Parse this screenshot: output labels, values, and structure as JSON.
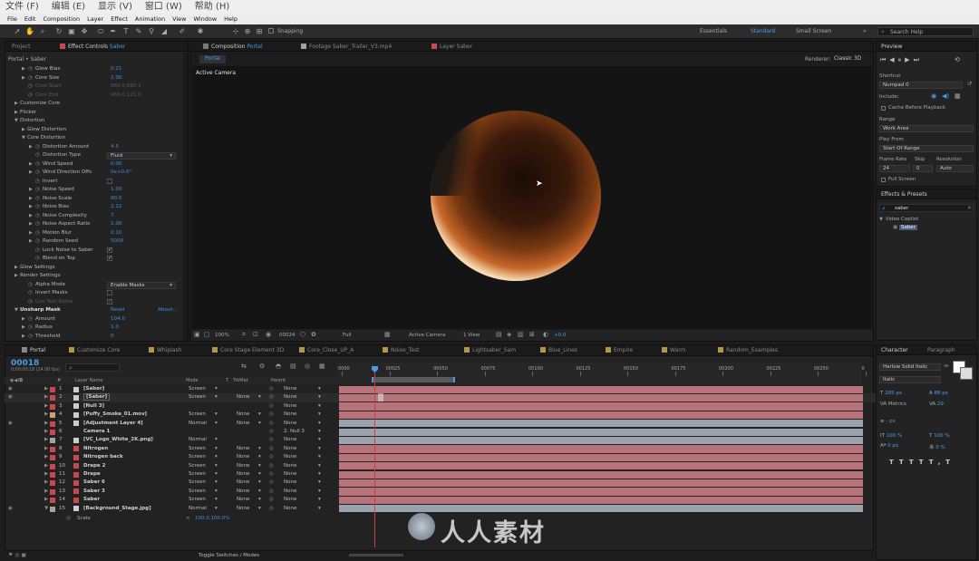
{
  "os_menu": [
    "文件 (F)",
    "编辑 (E)",
    "显示 (V)",
    "窗口 (W)",
    "帮助 (H)"
  ],
  "menubar": [
    "File",
    "Edit",
    "Composition",
    "Layer",
    "Effect",
    "Animation",
    "View",
    "Window",
    "Help"
  ],
  "toolbar": {
    "snapping": "Snapping",
    "workspaces": [
      "Essentials",
      "Standard",
      "Small Screen"
    ],
    "active_workspace": "Standard",
    "search_placeholder": "Search Help"
  },
  "left_panel": {
    "tab_project": "Project",
    "tab_effect_controls": "Effect Controls",
    "ec_layer": "Saber",
    "breadcrumb": "Portal • Saber",
    "rows": [
      {
        "label": "Glow Bias",
        "value": "0.21",
        "indent": 2,
        "toggle": "▶",
        "sw": true
      },
      {
        "label": "Core Size",
        "value": "2.00",
        "indent": 2,
        "toggle": "▶",
        "sw": true
      },
      {
        "label": "Core Start",
        "value": "960.0,690.2",
        "indent": 2,
        "toggle": "",
        "sw": true,
        "dim": true
      },
      {
        "label": "Core End",
        "value": "960.0,121.6",
        "indent": 2,
        "toggle": "",
        "sw": true,
        "dim": true
      },
      {
        "label": "Customize Core",
        "value": "",
        "indent": 1,
        "toggle": "▶",
        "sw": false
      },
      {
        "label": "Flicker",
        "value": "",
        "indent": 1,
        "toggle": "▶",
        "sw": false
      },
      {
        "label": "Distortion",
        "value": "",
        "indent": 1,
        "toggle": "▼",
        "sw": false
      },
      {
        "label": "Glow Distortion",
        "value": "",
        "indent": 2,
        "toggle": "▶",
        "sw": false
      },
      {
        "label": "Core Distortion",
        "value": "",
        "indent": 2,
        "toggle": "▼",
        "sw": false
      },
      {
        "label": "Distortion Amount",
        "value": "4.5",
        "indent": 3,
        "toggle": "▶",
        "sw": true
      },
      {
        "label": "Distortion Type",
        "value": "",
        "indent": 3,
        "toggle": "",
        "sw": true,
        "dropdown": "Fluid"
      },
      {
        "label": "Wind Speed",
        "value": "0.00",
        "indent": 3,
        "toggle": "▶",
        "sw": true
      },
      {
        "label": "Wind Direction Offs",
        "value": "0x+0.0°",
        "indent": 3,
        "toggle": "▶",
        "sw": true
      },
      {
        "label": "Invert",
        "value": "",
        "indent": 3,
        "toggle": "",
        "sw": true,
        "check": ""
      },
      {
        "label": "Noise Speed",
        "value": "1.00",
        "indent": 3,
        "toggle": "▶",
        "sw": true
      },
      {
        "label": "Noise Scale",
        "value": "90.0",
        "indent": 3,
        "toggle": "▶",
        "sw": true
      },
      {
        "label": "Noise Bias",
        "value": "2.12",
        "indent": 3,
        "toggle": "▶",
        "sw": true
      },
      {
        "label": "Noise Complexity",
        "value": "7",
        "indent": 3,
        "toggle": "▶",
        "sw": true
      },
      {
        "label": "Noise Aspect Ratio",
        "value": "1.00",
        "indent": 3,
        "toggle": "▶",
        "sw": true
      },
      {
        "label": "Motion Blur",
        "value": "0.10",
        "indent": 3,
        "toggle": "▶",
        "sw": true
      },
      {
        "label": "Random Seed",
        "value": "5000",
        "indent": 3,
        "toggle": "▶",
        "sw": true
      },
      {
        "label": "Lock Noise to Saber",
        "value": "",
        "indent": 3,
        "toggle": "",
        "sw": true,
        "check": "✓"
      },
      {
        "label": "Blend on Top",
        "value": "",
        "indent": 3,
        "toggle": "",
        "sw": true,
        "check": "✓"
      },
      {
        "label": "Glow Settings",
        "value": "",
        "indent": 1,
        "toggle": "▶",
        "sw": false
      },
      {
        "label": "Render Settings",
        "value": "",
        "indent": 1,
        "toggle": "▶",
        "sw": false
      },
      {
        "label": "Alpha Mode",
        "value": "",
        "indent": 2,
        "toggle": "",
        "sw": true,
        "dropdown": "Enable Masks"
      },
      {
        "label": "Invert Masks",
        "value": "",
        "indent": 2,
        "toggle": "",
        "sw": true,
        "check": ""
      },
      {
        "label": "Use Text Alpha",
        "value": "",
        "indent": 2,
        "toggle": "",
        "sw": true,
        "check": "✓",
        "dim": true
      },
      {
        "label": "Unsharp Mask",
        "value": "Reset",
        "indent": 1,
        "toggle": "▼",
        "sw": false,
        "about": "About...",
        "bold": true
      },
      {
        "label": "Amount",
        "value": "104.0",
        "indent": 2,
        "toggle": "▶",
        "sw": true
      },
      {
        "label": "Radius",
        "value": "1.0",
        "indent": 2,
        "toggle": "▶",
        "sw": true
      },
      {
        "label": "Threshold",
        "value": "0",
        "indent": 2,
        "toggle": "▶",
        "sw": true
      }
    ]
  },
  "composition": {
    "tab_comp": "Composition",
    "comp_name": "Portal",
    "tab_footage": "Footage Saber_Trailer_V3.mp4",
    "tab_layer": "Layer Saber",
    "crumb": "Portal",
    "renderer_label": "Renderer:",
    "renderer": "Classic 3D",
    "view_label": "Active Camera",
    "footer": {
      "zoom": "100%",
      "timecode": "00024",
      "resolution": "Full",
      "camera": "Active Camera",
      "views": "1 View",
      "exposure": "+0.0"
    }
  },
  "timeline_tabs": [
    "Portal",
    "Customize Core",
    "Whiplash",
    "Core Stage Element 3D",
    "Core_Close_UP_A",
    "Noise_Test",
    "Lightsaber_Sam",
    "Blue_Lines",
    "Empire",
    "Warm",
    "Random_Examples"
  ],
  "timeline": {
    "timecode": "00018",
    "fps": "0:00:00:18 (24.00 fps)",
    "col_num": "#",
    "col_name": "Layer Name",
    "col_mode": "Mode",
    "col_t": "T",
    "col_trkmat": "TrkMat",
    "col_parent": "Parent",
    "ruler": [
      "0000",
      "00025",
      "00050",
      "00075",
      "00100",
      "00125",
      "00150",
      "00175",
      "00200",
      "00225",
      "00250",
      "0"
    ],
    "layers": [
      {
        "num": "1",
        "name": "[Saber]",
        "mode": "Screen",
        "trk": "",
        "parent": "None",
        "color": "#c9474d",
        "bar": "#b8727a"
      },
      {
        "num": "2",
        "name": "[Saber]",
        "mode": "Screen",
        "trk": "None",
        "parent": "None",
        "color": "#c9474d",
        "bar": "#b8727a"
      },
      {
        "num": "3",
        "name": "[Null 3]",
        "mode": "",
        "trk": "",
        "parent": "None",
        "color": "#c9474d",
        "bar": "#b8727a"
      },
      {
        "num": "4",
        "name": "[Puffy_Smoke_01.mov]",
        "mode": "Screen",
        "trk": "None",
        "parent": "None",
        "color": "#c8a46e",
        "bar": "#b8727a"
      },
      {
        "num": "5",
        "name": "[Adjustment Layer 4]",
        "mode": "Normal",
        "trk": "None",
        "parent": "None",
        "color": "#c9474d",
        "bar": "#9aa3ad"
      },
      {
        "num": "6",
        "name": "Camera 1",
        "mode": "",
        "trk": "",
        "parent": "2. Null 3",
        "color": "#c9474d",
        "bar": "#9aa3ad"
      },
      {
        "num": "7",
        "name": "[VC_Logo_White_2K.png]",
        "mode": "Normal",
        "trk": "",
        "parent": "None",
        "color": "#a4a4a4",
        "bar": "#9aa3ad"
      },
      {
        "num": "8",
        "name": "Nitrogen",
        "mode": "Screen",
        "trk": "None",
        "parent": "None",
        "color": "#c9474d",
        "bar": "#b8727a"
      },
      {
        "num": "9",
        "name": "Nitrogen back",
        "mode": "Screen",
        "trk": "None",
        "parent": "None",
        "color": "#c9474d",
        "bar": "#b8727a"
      },
      {
        "num": "10",
        "name": "Drape 2",
        "mode": "Screen",
        "trk": "None",
        "parent": "None",
        "color": "#c9474d",
        "bar": "#b8727a"
      },
      {
        "num": "11",
        "name": "Drape",
        "mode": "Screen",
        "trk": "None",
        "parent": "None",
        "color": "#c9474d",
        "bar": "#b8727a"
      },
      {
        "num": "12",
        "name": "Saber 6",
        "mode": "Screen",
        "trk": "None",
        "parent": "None",
        "color": "#c9474d",
        "bar": "#b8727a"
      },
      {
        "num": "13",
        "name": "Saber 3",
        "mode": "Screen",
        "trk": "None",
        "parent": "None",
        "color": "#c9474d",
        "bar": "#b8727a"
      },
      {
        "num": "14",
        "name": "Saber",
        "mode": "Screen",
        "trk": "None",
        "parent": "None",
        "color": "#c9474d",
        "bar": "#b8727a"
      },
      {
        "num": "15",
        "name": "[Background_Stage.jpg]",
        "mode": "Normal",
        "trk": "None",
        "parent": "None",
        "color": "#a4a4a4",
        "bar": "#9aa3ad"
      }
    ],
    "scale_label": "Scale",
    "scale_value": "100.0,100.0%",
    "toggle_label": "Toggle Switches / Modes"
  },
  "preview": {
    "title": "Preview",
    "shortcut_label": "Shortcut",
    "shortcut": "Numpad 0",
    "include_label": "Include:",
    "cache": "Cache Before Playback",
    "range_label": "Range",
    "range": "Work Area",
    "playfrom_label": "Play From",
    "playfrom": "Start Of Range",
    "framerate_label": "Frame Rate",
    "skip_label": "Skip",
    "resolution_label": "Resolution",
    "framerate": "24",
    "skip": "0",
    "resolution": "Auto",
    "fullscreen": "Full Screen"
  },
  "effects": {
    "title": "Effects & Presets",
    "search": "saber",
    "category": "Video Copilot",
    "item": "Saber"
  },
  "character": {
    "tab_char": "Character",
    "tab_para": "Paragraph",
    "font": "Harlow Solid Italic",
    "style": "Italic",
    "size": "285 px",
    "leading": "88 px",
    "kerning": "Metrics",
    "tracking": "29",
    "stroke": "- px",
    "vscale": "100 %",
    "hscale": "100 %",
    "baseline": "0 px",
    "tsume": "0 %"
  },
  "watermark": "人人素材"
}
